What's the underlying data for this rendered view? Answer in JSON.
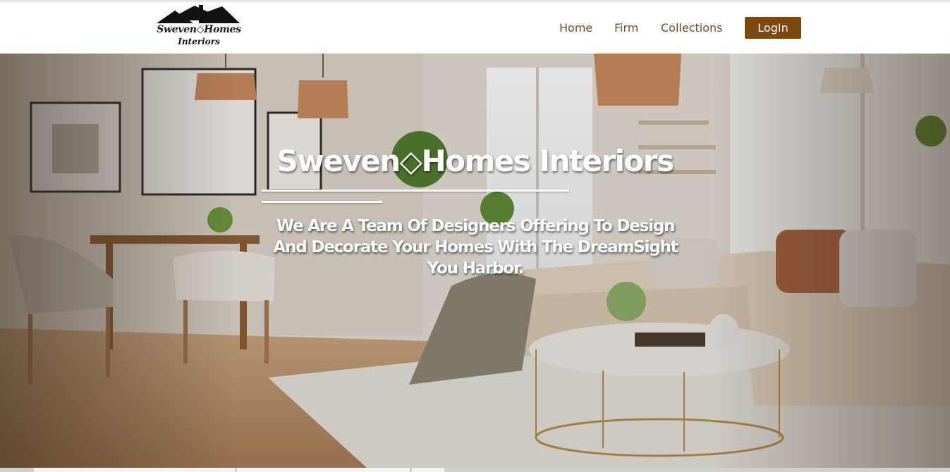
{
  "logo": {
    "line1": "Sweven◇Homes",
    "line2": "Interiors"
  },
  "nav": {
    "home": "Home",
    "firm": "Firm",
    "collections": "Collections",
    "login": "LogIn"
  },
  "hero": {
    "title": "Sweven◇Homes Interiors",
    "tagline": "We Are A Team Of Designers Offering To Design And Decorate Your Homes With The DreamSight You Harbor."
  },
  "colors": {
    "login_bg": "#7a4810",
    "nav_link": "#6b5034",
    "hero_text": "#ffffff"
  }
}
